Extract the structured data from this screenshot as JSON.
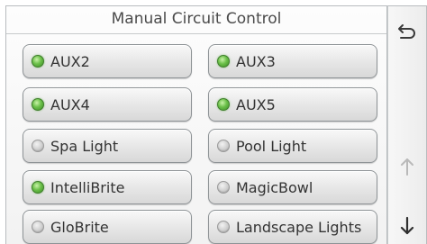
{
  "header": {
    "title": "Manual Circuit Control"
  },
  "circuits": [
    {
      "label": "AUX2",
      "state": "on"
    },
    {
      "label": "AUX3",
      "state": "on"
    },
    {
      "label": "AUX4",
      "state": "on"
    },
    {
      "label": "AUX5",
      "state": "on"
    },
    {
      "label": "Spa Light",
      "state": "off"
    },
    {
      "label": "Pool Light",
      "state": "off"
    },
    {
      "label": "IntelliBrite",
      "state": "on"
    },
    {
      "label": "MagicBowl",
      "state": "off"
    },
    {
      "label": "GloBrite",
      "state": "off"
    },
    {
      "label": "Landscape Lights",
      "state": "off"
    }
  ],
  "side": {
    "back_icon": "back-arrow-icon",
    "up_icon": "arrow-up-icon",
    "down_icon": "arrow-down-icon"
  },
  "colors": {
    "led_on": "#5cb83c",
    "led_off": "#c8c8c8",
    "text": "#333333",
    "header_text": "#4a4a4a"
  }
}
